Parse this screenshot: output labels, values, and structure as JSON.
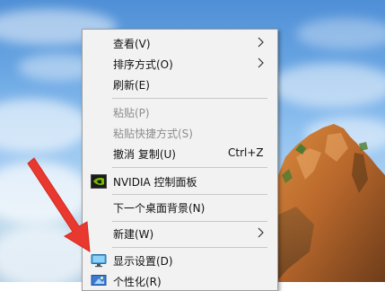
{
  "context_menu": {
    "items": [
      {
        "label": "查看(V)"
      },
      {
        "label": "排序方式(O)"
      },
      {
        "label": "刷新(E)"
      },
      {
        "label": "粘贴(P)"
      },
      {
        "label": "粘贴快捷方式(S)"
      },
      {
        "label": "撤消 复制(U)",
        "shortcut": "Ctrl+Z"
      },
      {
        "label": "NVIDIA 控制面板",
        "icon": "nvidia-icon"
      },
      {
        "label": "下一个桌面背景(N)"
      },
      {
        "label": "新建(W)"
      },
      {
        "label": "显示设置(D)",
        "icon": "display-icon"
      },
      {
        "label": "个性化(R)",
        "icon": "personalize-icon"
      }
    ]
  },
  "colors": {
    "menu_background": "#f2f2f2",
    "menu_border": "#a0a0a0",
    "annotation_arrow": "#e8382f",
    "nvidia_green": "#76b900"
  }
}
